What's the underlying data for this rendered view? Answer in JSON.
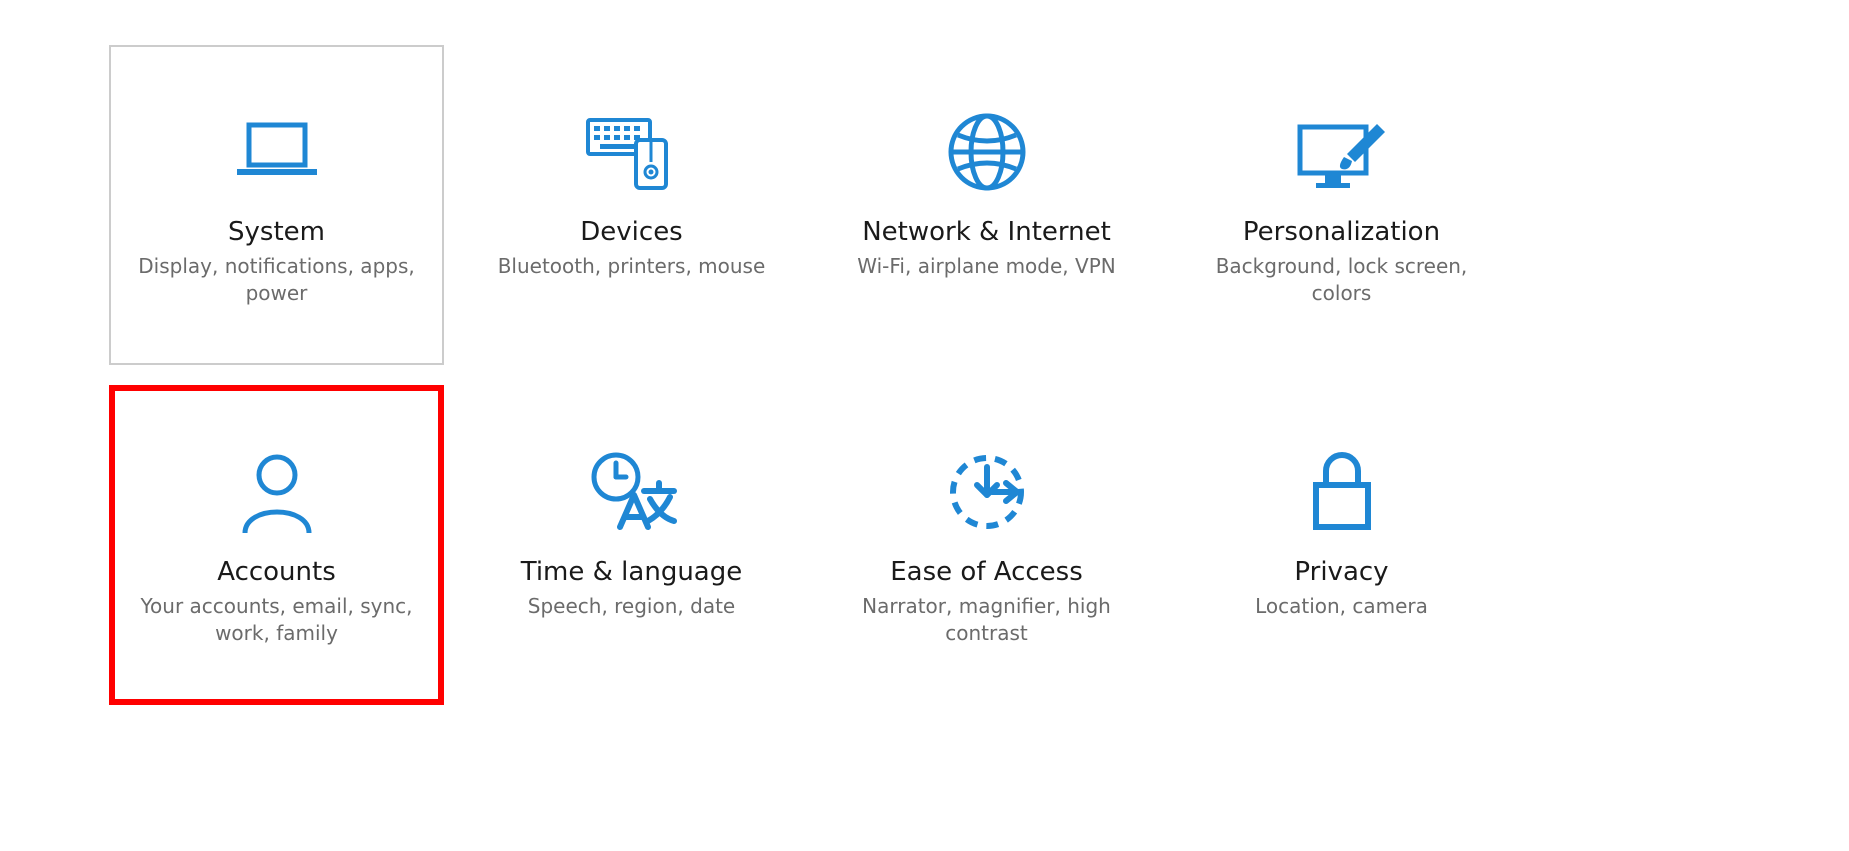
{
  "accent": "#1f87d4",
  "tiles": [
    {
      "id": "system",
      "title": "System",
      "subtitle": "Display, notifications, apps, power"
    },
    {
      "id": "devices",
      "title": "Devices",
      "subtitle": "Bluetooth, printers, mouse"
    },
    {
      "id": "network",
      "title": "Network & Internet",
      "subtitle": "Wi-Fi, airplane mode, VPN"
    },
    {
      "id": "personalization",
      "title": "Personalization",
      "subtitle": "Background, lock screen, colors"
    },
    {
      "id": "accounts",
      "title": "Accounts",
      "subtitle": "Your accounts, email, sync, work, family"
    },
    {
      "id": "time-language",
      "title": "Time & language",
      "subtitle": "Speech, region, date"
    },
    {
      "id": "ease-of-access",
      "title": "Ease of Access",
      "subtitle": "Narrator, magnifier, high contrast"
    },
    {
      "id": "privacy",
      "title": "Privacy",
      "subtitle": "Location, camera"
    }
  ]
}
